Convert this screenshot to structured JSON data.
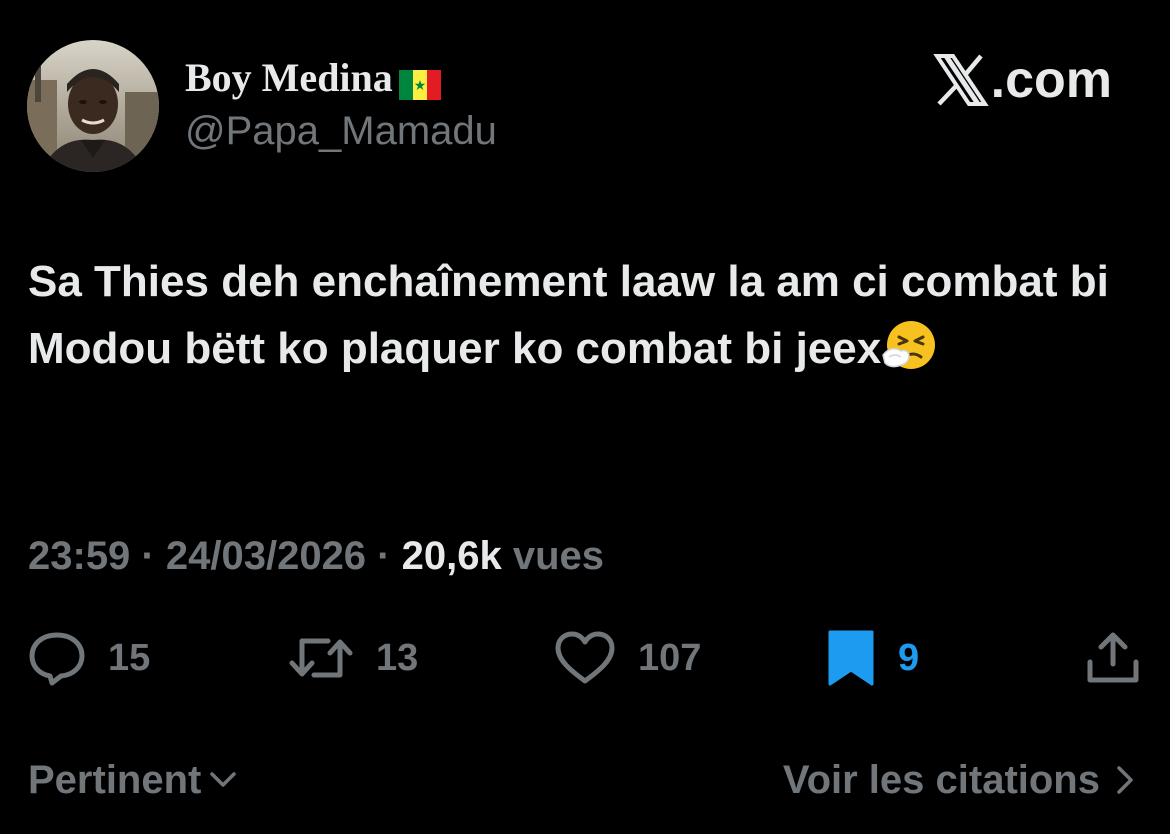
{
  "author": {
    "display_name": "Boy Medina",
    "flag_icon": "senegal-flag-icon",
    "handle": "@Papa_Mamadu",
    "avatar": "profile-photo"
  },
  "brand": {
    "logo_icon": "x-logo-icon",
    "label": ".com"
  },
  "tweet": {
    "text": "Sa Thies deh enchaînement laaw la am ci combat bi Modou bëtt ko plaquer ko combat bi jeex",
    "emoji": "sneezing-face-emoji"
  },
  "meta": {
    "time": "23:59",
    "separator": " · ",
    "date": "24/03/2026",
    "views_count": "20,6k",
    "views_label": "vues"
  },
  "actions": {
    "replies": "15",
    "reposts": "13",
    "likes": "107",
    "bookmarks": "9"
  },
  "footer": {
    "sort_label": "Pertinent",
    "quotes_label": "Voir les citations"
  },
  "colors": {
    "background": "#000000",
    "text_primary": "#e7e9ea",
    "text_secondary": "#71767b",
    "accent": "#1d9bf0"
  }
}
